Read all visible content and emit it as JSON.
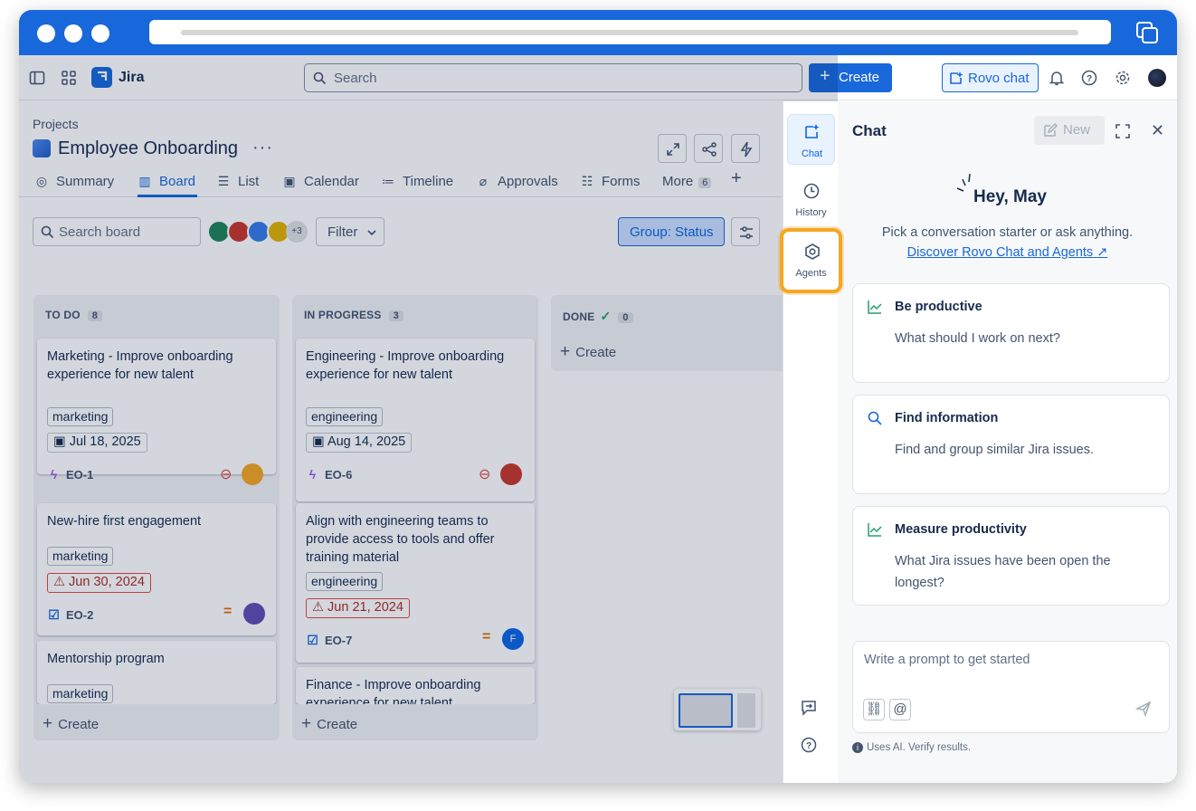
{
  "app": {
    "name": "Jira"
  },
  "topnav": {
    "search_placeholder": "Search",
    "create_label": "Create",
    "rovo_label": "Rovo chat"
  },
  "project": {
    "breadcrumb": "Projects",
    "title": "Employee Onboarding",
    "more": "···"
  },
  "tabs": [
    {
      "label": "Summary",
      "icon": "globe-icon"
    },
    {
      "label": "Board",
      "icon": "board-icon"
    },
    {
      "label": "List",
      "icon": "list-icon"
    },
    {
      "label": "Calendar",
      "icon": "calendar-icon"
    },
    {
      "label": "Timeline",
      "icon": "timeline-icon"
    },
    {
      "label": "Approvals",
      "icon": "paperclip-icon"
    },
    {
      "label": "Forms",
      "icon": "forms-icon"
    },
    {
      "label": "More",
      "count": "6"
    }
  ],
  "toolbar": {
    "search_placeholder": "Search board",
    "avatar_more": "+3",
    "filter_label": "Filter",
    "group_label": "Group: Status"
  },
  "columns": [
    {
      "title": "TO DO",
      "count": "8",
      "cards": [
        {
          "title": "Marketing - Improve onboarding experience for new talent",
          "label": "marketing",
          "date": "Jul 18, 2025",
          "overdue": false,
          "key": "EO-1",
          "type": "epic"
        },
        {
          "title": "New-hire first engagement",
          "label": "marketing",
          "date": "Jun 30, 2024",
          "overdue": true,
          "key": "EO-2",
          "type": "task"
        },
        {
          "title": "Mentorship program",
          "label": "marketing"
        }
      ],
      "create": "Create"
    },
    {
      "title": "IN PROGRESS",
      "count": "3",
      "cards": [
        {
          "title": "Engineering - Improve onboarding experience for new talent",
          "label": "engineering",
          "date": "Aug 14, 2025",
          "overdue": false,
          "key": "EO-6",
          "type": "epic"
        },
        {
          "title": "Align with engineering teams to provide access to tools and offer training material",
          "label": "engineering",
          "date": "Jun 21, 2024",
          "overdue": true,
          "key": "EO-7",
          "type": "task",
          "assignee_initial": "F"
        },
        {
          "title": "Finance - Improve onboarding experience for new talent"
        }
      ],
      "create": "Create"
    },
    {
      "title": "DONE",
      "count": "0",
      "create": "Create"
    }
  ],
  "rail": {
    "chat": "Chat",
    "history": "History",
    "agents": "Agents"
  },
  "chat": {
    "title": "Chat",
    "new_label": "New",
    "greeting": "Hey, May",
    "subtitle": "Pick a conversation starter or ask anything.",
    "discover": "Discover Rovo Chat and Agents",
    "starters": [
      {
        "heading": "Be productive",
        "prompt": "What should I work on next?",
        "icon": "trend-icon"
      },
      {
        "heading": "Find information",
        "prompt": "Find and group similar Jira issues.",
        "icon": "search-icon"
      },
      {
        "heading": "Measure productivity",
        "prompt": "What Jira issues have been open the longest?",
        "icon": "trend-icon"
      }
    ],
    "prompt_placeholder": "Write a prompt to get started",
    "disclaimer": "Uses AI. Verify results."
  },
  "colors": {
    "brand": "#1868db",
    "highlight": "#f5a623",
    "overdue": "#ae2e24"
  }
}
